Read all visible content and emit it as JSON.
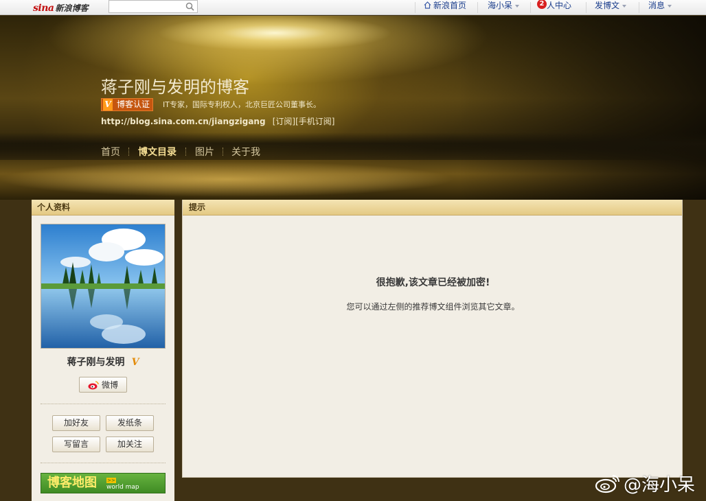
{
  "topbar": {
    "logo_sina": "sina",
    "logo_text": "新浪博客",
    "search_placeholder": "",
    "nav": {
      "home": "新浪首页",
      "user": "海小呆",
      "badge_count": "2",
      "center": "人中心",
      "post": "发博文",
      "messages": "消息"
    }
  },
  "banner": {
    "title": "蒋子刚与发明的博客",
    "cert_label": "博客认证",
    "cert_mark": "V",
    "cert_desc": "IT专家，国际专利权人，北京巨匠公司董事长。",
    "url": "http://blog.sina.com.cn/jiangzigang",
    "subscribe": "[订阅]",
    "mobile_subscribe": "[手机订阅]",
    "nav": [
      "首页",
      "博文目录",
      "图片",
      "关于我"
    ],
    "active_nav": "博文目录"
  },
  "sidebar": {
    "header": "个人资料",
    "nickname": "蒋子刚与发明",
    "verified_mark": "V",
    "weibo_label": "微博",
    "buttons": [
      "加好友",
      "发纸条",
      "写留言",
      "加关注"
    ],
    "map_title": "博客地图",
    "map_sub": "world map"
  },
  "main": {
    "header": "提示",
    "message_title": "很抱歉,该文章已经被加密!",
    "message_body": "您可以通过左侧的推荐博文组件浏览其它文章。"
  },
  "watermark": {
    "text": "@海小呆"
  },
  "colors": {
    "banner_gold": "#f4dd93",
    "header_bar": "#e4c983",
    "panel_bg": "#f2eee5",
    "accent_red": "#c20f0f",
    "cert_orange": "#c5560f"
  }
}
